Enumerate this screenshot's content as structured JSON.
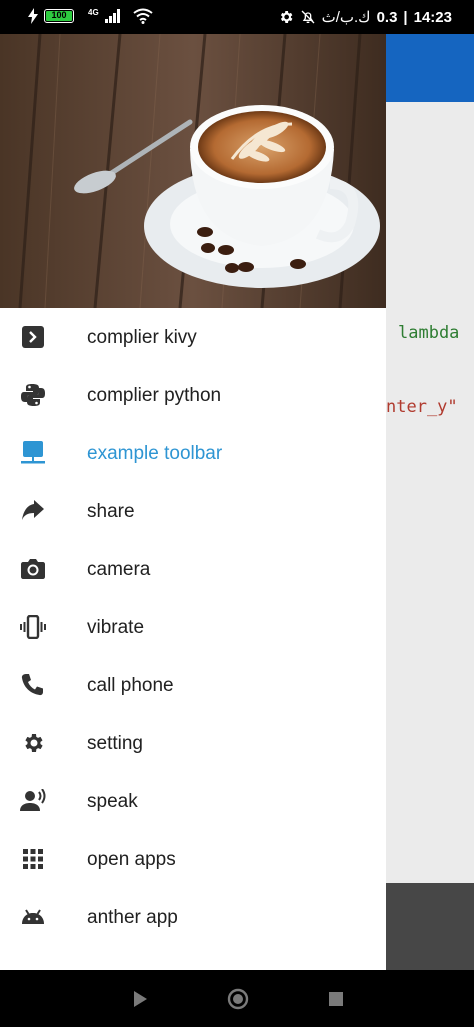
{
  "status_bar": {
    "battery": "100",
    "network": "4G",
    "speed": "0.3",
    "speed_unit": "ك.ب/ث",
    "separator": "|",
    "time": "14:23"
  },
  "background_code": {
    "line1": "lambda",
    "line2": "nter_y\""
  },
  "drawer": {
    "items": [
      {
        "label": "complier kivy",
        "icon": "terminal-icon"
      },
      {
        "label": "complier python",
        "icon": "python-icon"
      },
      {
        "label": "example toolbar",
        "icon": "desktop-icon",
        "active": true
      },
      {
        "label": "share",
        "icon": "share-icon"
      },
      {
        "label": "camera",
        "icon": "camera-icon"
      },
      {
        "label": "vibrate",
        "icon": "vibrate-icon"
      },
      {
        "label": "call phone",
        "icon": "phone-icon"
      },
      {
        "label": "setting",
        "icon": "gear-icon"
      },
      {
        "label": "speak",
        "icon": "speak-icon"
      },
      {
        "label": "open apps",
        "icon": "apps-grid-icon"
      },
      {
        "label": "anther app",
        "icon": "android-icon"
      }
    ]
  },
  "colors": {
    "accent": "#2e95d3",
    "appbar": "#1565c0",
    "text": "#212121",
    "icon": "#333333",
    "code_green": "#2e7d32",
    "code_red": "#b03a2e"
  }
}
